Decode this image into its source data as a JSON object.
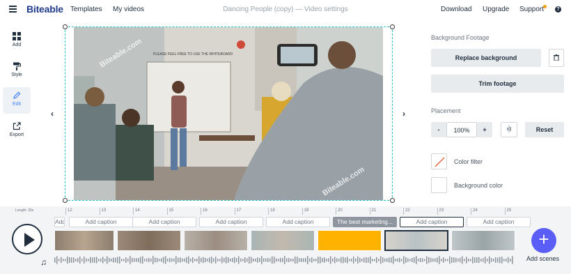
{
  "header": {
    "logo": "Biteable",
    "nav": [
      "Templates",
      "My videos"
    ],
    "project_name": "Dancing People (copy)",
    "separator": "—",
    "section": "Video settings",
    "right_links": [
      "Download",
      "Upgrade",
      "Support"
    ],
    "help_glyph": "?"
  },
  "sidebar": {
    "items": [
      {
        "label": "Add",
        "icon": "grid-icon"
      },
      {
        "label": "Style",
        "icon": "paint-roller-icon"
      },
      {
        "label": "Edit",
        "icon": "pencil-icon",
        "active": true
      },
      {
        "label": "Export",
        "icon": "export-icon"
      }
    ]
  },
  "stage": {
    "prev_glyph": "‹",
    "next_glyph": "›",
    "whiteboard_text": "PLEASE FEEL FREE TO USE THE WHITEBOARD",
    "watermark": "Biteable.com"
  },
  "panel": {
    "background_footage_label": "Background Footage",
    "replace_background": "Replace background",
    "trim_footage": "Trim footage",
    "placement_label": "Placement",
    "zoom_minus": "-",
    "zoom_value": "100%",
    "zoom_plus": "+",
    "reset": "Reset",
    "color_filter": "Color filter",
    "background_color": "Background color"
  },
  "timeline": {
    "length_label": "Length: 30s",
    "ticks": [
      "12",
      "13",
      "14",
      "15",
      "16",
      "17",
      "18",
      "19",
      "20",
      "21",
      "22",
      "23",
      "24",
      "25"
    ],
    "captions": [
      {
        "label": "Add caption",
        "state": "empty"
      },
      {
        "label": "Add caption",
        "state": "empty"
      },
      {
        "label": "Add caption",
        "state": "empty"
      },
      {
        "label": "Add caption",
        "state": "empty"
      },
      {
        "label": "Add caption",
        "state": "empty"
      },
      {
        "label": "The best marketing...",
        "state": "filled"
      },
      {
        "label": "Add caption",
        "state": "selected"
      },
      {
        "label": "Add caption",
        "state": "empty"
      }
    ],
    "add_scenes": "Add scenes",
    "colors": {
      "accent": "#5b5ef6",
      "highlight_scene": "#ffb300",
      "selection": "#22c3c9"
    }
  }
}
